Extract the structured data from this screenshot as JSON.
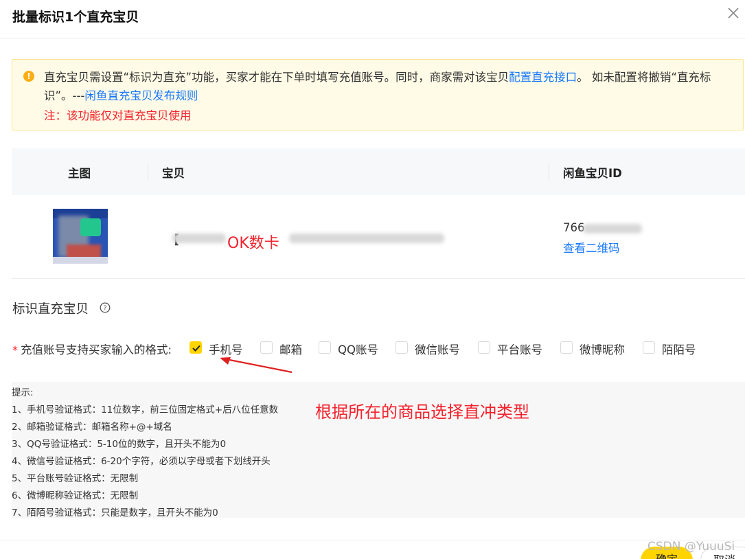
{
  "modal": {
    "title": "批量标识1个直充宝贝",
    "close_label": "×"
  },
  "alert": {
    "icon": "!",
    "text_part1": "直充宝贝需设置“标识为直充”功能，买家才能在下单时填写充值账号。同时，商家需对该宝贝",
    "link1": "配置直充接口",
    "text_part2": "。 如未配置将撤销“直充标识”。---",
    "link2": "闲鱼直充宝贝发布规则",
    "note": "注：该功能仅对直充宝贝使用"
  },
  "table": {
    "headers": [
      "主图",
      "宝贝",
      "闲鱼宝贝ID"
    ],
    "row": {
      "title_prefix": "【",
      "annotation": "OK数卡",
      "item_id": "766",
      "qr_link": "查看二维码"
    }
  },
  "section": {
    "title": "标识直充宝贝"
  },
  "form": {
    "required_mark": "*",
    "label": "充值账号支持买家输入的格式:",
    "options": [
      {
        "label": "手机号",
        "checked": true
      },
      {
        "label": "邮箱",
        "checked": false
      },
      {
        "label": "QQ账号",
        "checked": false
      },
      {
        "label": "微信账号",
        "checked": false
      },
      {
        "label": "平台账号",
        "checked": false
      },
      {
        "label": "微博昵称",
        "checked": false
      },
      {
        "label": "陌陌号",
        "checked": false
      }
    ]
  },
  "tips": {
    "lines": [
      "提示:",
      "1、手机号验证格式：11位数字，前三位固定格式+后八位任意数",
      "2、邮箱验证格式：邮箱名称+@+域名",
      "3、QQ号验证格式：5-10位的数字，且开头不能为0",
      "4、微信号验证格式：6-20个字符，必须以字母或者下划线开头",
      "5、平台账号验证格式：无限制",
      "6、微博昵称验证格式：无限制",
      "7、陌陌号验证格式：只能是数字，且开头不能为0"
    ],
    "annotation": "根据所在的商品选择直冲类型"
  },
  "footer": {
    "ok_label": "确定",
    "cancel_label": "取消",
    "watermark": "CSDN @YuuuSi"
  }
}
